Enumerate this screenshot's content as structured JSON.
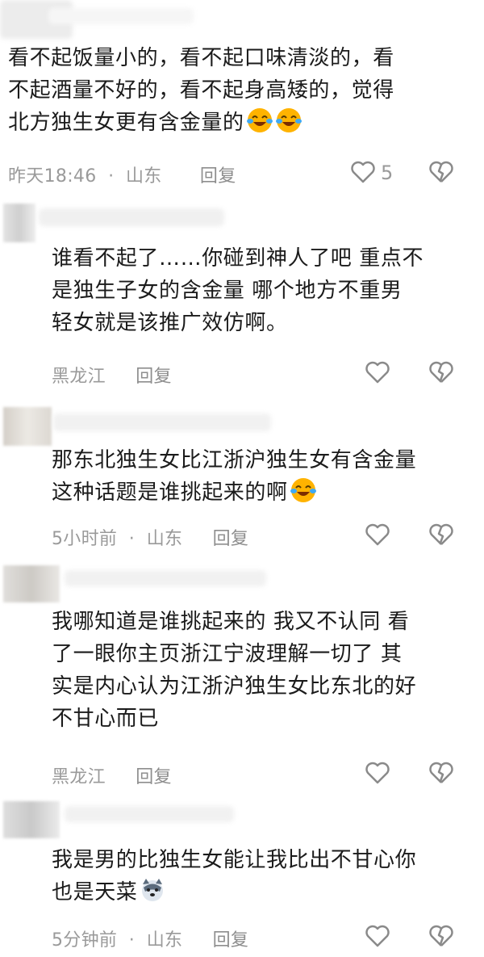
{
  "comments": [
    {
      "lines": [
        "看不起饭量小的，看不起口味清淡的，看",
        "不起酒量不好的，看不起身高矮的，觉得",
        "北方独生女更有含金量的"
      ],
      "meta": {
        "time": "昨天18:46",
        "location": "山东",
        "reply": "回复",
        "likes": "5"
      }
    },
    {
      "lines": [
        "谁看不起了……你碰到神人了吧 重点不",
        "是独生子女的含金量 哪个地方不重男",
        "轻女就是该推广效仿啊。"
      ],
      "meta": {
        "location": "黑龙江",
        "reply": "回复"
      }
    },
    {
      "lines": [
        "那东北独生女比江浙沪独生女有含金量",
        "这种话题是谁挑起来的啊"
      ],
      "meta": {
        "time": "5小时前",
        "location": "山东",
        "reply": "回复"
      }
    },
    {
      "lines": [
        "我哪知道是谁挑起来的 我又不认同 看",
        "了一眼你主页浙江宁波理解一切了 其",
        "实是内心认为江浙沪独生女比东北的好",
        "不甘心而已"
      ],
      "meta": {
        "location": "黑龙江",
        "reply": "回复"
      }
    },
    {
      "lines": [
        "我是男的比独生女能让我比出不甘心你",
        "也是天菜"
      ],
      "meta": {
        "time": "5分钟前",
        "location": "山东",
        "reply": "回复"
      }
    }
  ],
  "colors": {
    "text": "#1b1b1b",
    "meta": "#9a9a9a",
    "icon": "#8a8a8a",
    "emoji_face": "#ffb300"
  },
  "icons": [
    "heart-outline-icon",
    "broken-heart-outline-icon",
    "laughing-tears-emoji",
    "dog-face-emoji"
  ]
}
